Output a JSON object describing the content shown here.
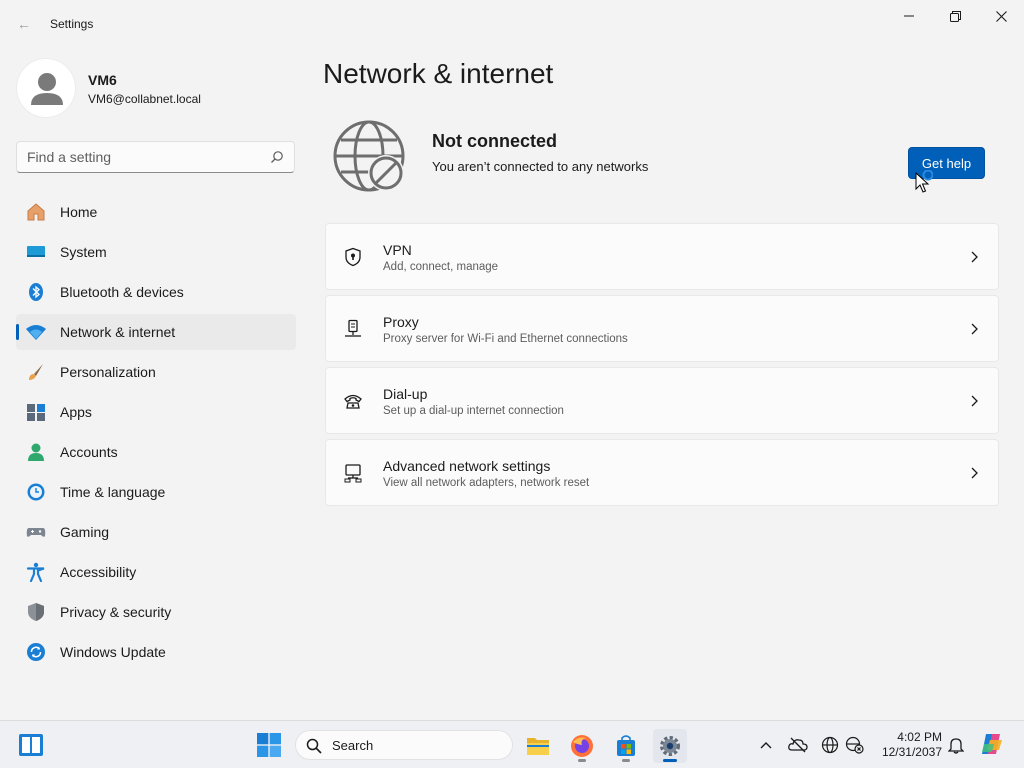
{
  "window": {
    "app_title": "Settings",
    "back": "←"
  },
  "profile": {
    "name": "VM6",
    "email": "VM6@collabnet.local"
  },
  "search": {
    "placeholder": "Find a setting"
  },
  "sidebar": {
    "items": [
      {
        "label": "Home",
        "icon": "home-icon"
      },
      {
        "label": "System",
        "icon": "system-icon"
      },
      {
        "label": "Bluetooth & devices",
        "icon": "bluetooth-icon"
      },
      {
        "label": "Network & internet",
        "icon": "wifi-icon",
        "active": true
      },
      {
        "label": "Personalization",
        "icon": "brush-icon"
      },
      {
        "label": "Apps",
        "icon": "apps-icon"
      },
      {
        "label": "Accounts",
        "icon": "accounts-icon"
      },
      {
        "label": "Time & language",
        "icon": "clock-globe-icon"
      },
      {
        "label": "Gaming",
        "icon": "gamepad-icon"
      },
      {
        "label": "Accessibility",
        "icon": "accessibility-icon"
      },
      {
        "label": "Privacy & security",
        "icon": "shield-icon"
      },
      {
        "label": "Windows Update",
        "icon": "update-icon"
      }
    ]
  },
  "main": {
    "title": "Network & internet",
    "status": {
      "title": "Not connected",
      "subtitle": "You aren’t connected to any networks",
      "help_button": "Get help"
    },
    "cards": [
      {
        "title": "VPN",
        "subtitle": "Add, connect, manage",
        "icon": "vpn-shield-icon"
      },
      {
        "title": "Proxy",
        "subtitle": "Proxy server for Wi-Fi and Ethernet connections",
        "icon": "proxy-icon"
      },
      {
        "title": "Dial-up",
        "subtitle": "Set up a dial-up internet connection",
        "icon": "dialup-phone-icon"
      },
      {
        "title": "Advanced network settings",
        "subtitle": "View all network adapters, network reset",
        "icon": "advanced-network-icon"
      }
    ]
  },
  "taskbar": {
    "search_label": "Search",
    "time": "4:02 PM",
    "date": "12/31/2037"
  },
  "colors": {
    "accent": "#005fb8",
    "background": "#f3f3f3",
    "card": "#fbfbfb"
  }
}
